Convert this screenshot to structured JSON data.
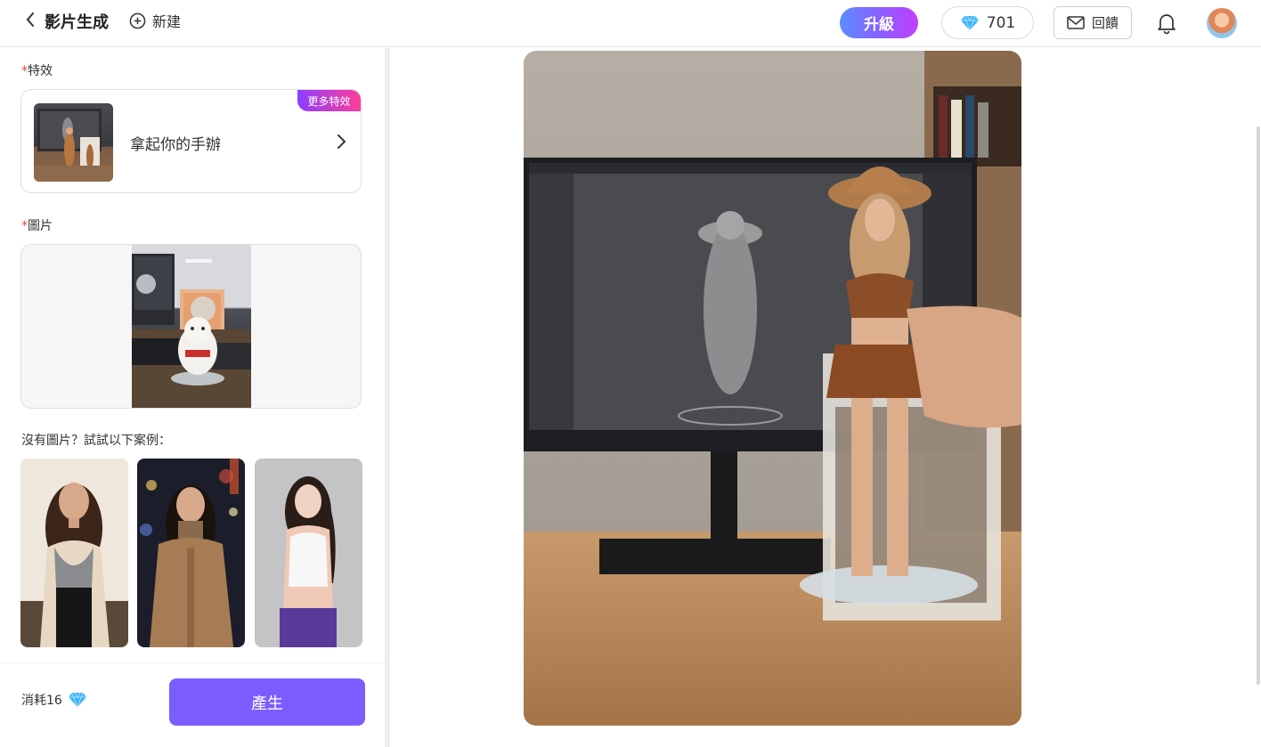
{
  "header": {
    "title": "影片生成",
    "new_label": "新建",
    "upgrade_label": "升級",
    "credits": "701",
    "feedback_label": "回饋"
  },
  "effect": {
    "section_label": "特效",
    "name": "拿起你的手辦",
    "more_badge": "更多特效"
  },
  "image": {
    "section_label": "圖片"
  },
  "examples": {
    "prompt": "沒有圖片？試試以下案例："
  },
  "footer": {
    "cost_label": "消耗16",
    "generate_label": "產生"
  },
  "colors": {
    "accent": "#7a5cff",
    "required_star": "#e8473f"
  }
}
